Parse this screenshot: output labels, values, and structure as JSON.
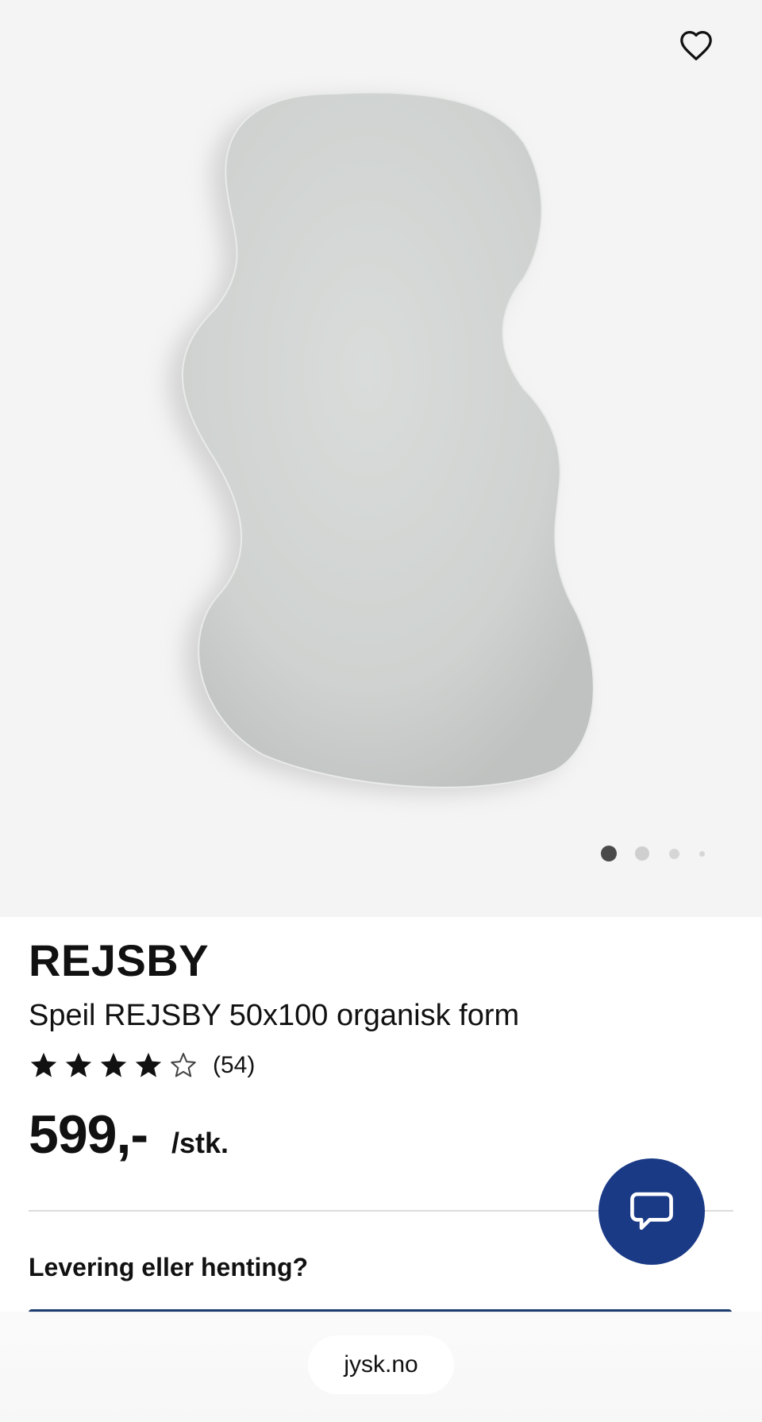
{
  "product": {
    "brand": "REJSBY",
    "name": "Speil REJSBY 50x100 organisk form",
    "rating": {
      "stars": 4,
      "max_stars": 5,
      "count_text": "(54)"
    },
    "price": {
      "amount": "599,-",
      "unit": "/stk."
    }
  },
  "gallery": {
    "current_index": 1,
    "total_indicators": 4
  },
  "delivery": {
    "heading": "Levering eller henting?"
  },
  "browser": {
    "url": "jysk.no"
  },
  "icons": {
    "favorite": "heart-outline-icon",
    "chat": "chat-bubble-icon",
    "star_filled": "star-filled-icon",
    "star_empty": "star-outline-icon"
  },
  "colors": {
    "chat_button": "#1a3a86",
    "accent_line": "#1c3b6e",
    "hero_background": "#f4f4f4"
  }
}
